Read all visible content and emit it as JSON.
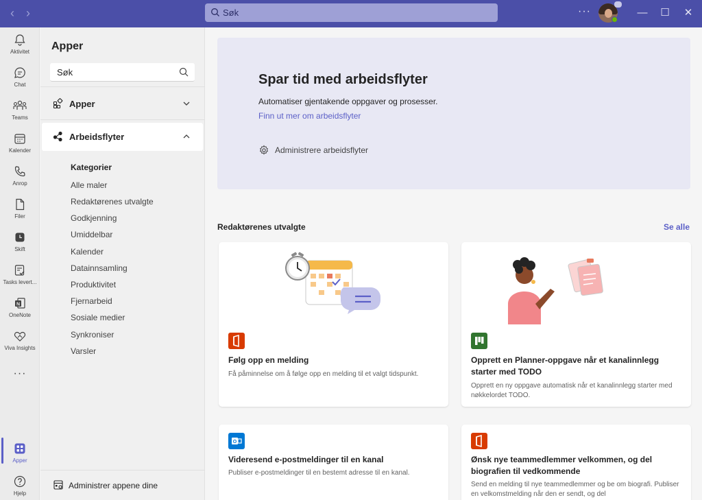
{
  "titlebar": {
    "search_placeholder": "Søk",
    "more_label": "···"
  },
  "rail": {
    "items": [
      {
        "label": "Aktivitet",
        "icon": "bell-icon"
      },
      {
        "label": "Chat",
        "icon": "chat-icon"
      },
      {
        "label": "Teams",
        "icon": "teams-icon"
      },
      {
        "label": "Kalender",
        "icon": "calendar-icon"
      },
      {
        "label": "Anrop",
        "icon": "phone-icon"
      },
      {
        "label": "Filer",
        "icon": "file-icon"
      },
      {
        "label": "Skift",
        "icon": "clock-icon"
      },
      {
        "label": "Tasks levert...",
        "icon": "tasks-icon"
      },
      {
        "label": "OneNote",
        "icon": "onenote-icon"
      },
      {
        "label": "Viva Insights",
        "icon": "viva-insights-icon"
      }
    ],
    "more": "···",
    "apps_label": "Apper",
    "help_label": "Hjelp"
  },
  "panel": {
    "title": "Apper",
    "search_placeholder": "Søk",
    "sections": [
      {
        "label": "Apper",
        "expanded": false
      },
      {
        "label": "Arbeidsflyter",
        "expanded": true
      }
    ],
    "categories_heading": "Kategorier",
    "categories": [
      "Alle maler",
      "Redaktørenes utvalgte",
      "Godkjenning",
      "Umiddelbar",
      "Kalender",
      "Datainnsamling",
      "Produktivitet",
      "Fjernarbeid",
      "Sosiale medier",
      "Synkroniser",
      "Varsler"
    ],
    "manage_label": "Administrer appene dine"
  },
  "hero": {
    "title": "Spar tid med arbeidsflyter",
    "subtitle": "Automatiser gjentakende oppgaver og prosesser.",
    "link": "Finn ut mer om arbeidsflyter",
    "action": "Administrere arbeidsflyter"
  },
  "featured": {
    "title": "Redaktørenes utvalgte",
    "see_all": "Se alle",
    "cards": [
      {
        "title": "Følg opp en melding",
        "desc": "Få påminnelse om å følge opp en melding til et valgt tidspunkt.",
        "app_color": "#d83b01"
      },
      {
        "title": "Opprett en Planner-oppgave når et kanalinnlegg starter med TODO",
        "desc": "Opprett en ny oppgave automatisk når et kanalinnlegg starter med nøkkelordet TODO.",
        "app_color": "#31752f"
      },
      {
        "title": "Videresend e-postmeldinger til en kanal",
        "desc": "Publiser e-postmeldinger til en bestemt adresse til en kanal.",
        "app_color": "#0078d4"
      },
      {
        "title": "Ønsk nye teammedlemmer velkommen, og del biografien til vedkommende",
        "desc": "Send en melding til nye teammedlemmer og be om biografi. Publiser en velkomstmelding når den er sendt, og del",
        "app_color": "#d83b01"
      }
    ]
  },
  "colors": {
    "titlebar": "#4b4fa8",
    "accent": "#5b5fc7",
    "hero_bg": "#e8e8f4"
  }
}
